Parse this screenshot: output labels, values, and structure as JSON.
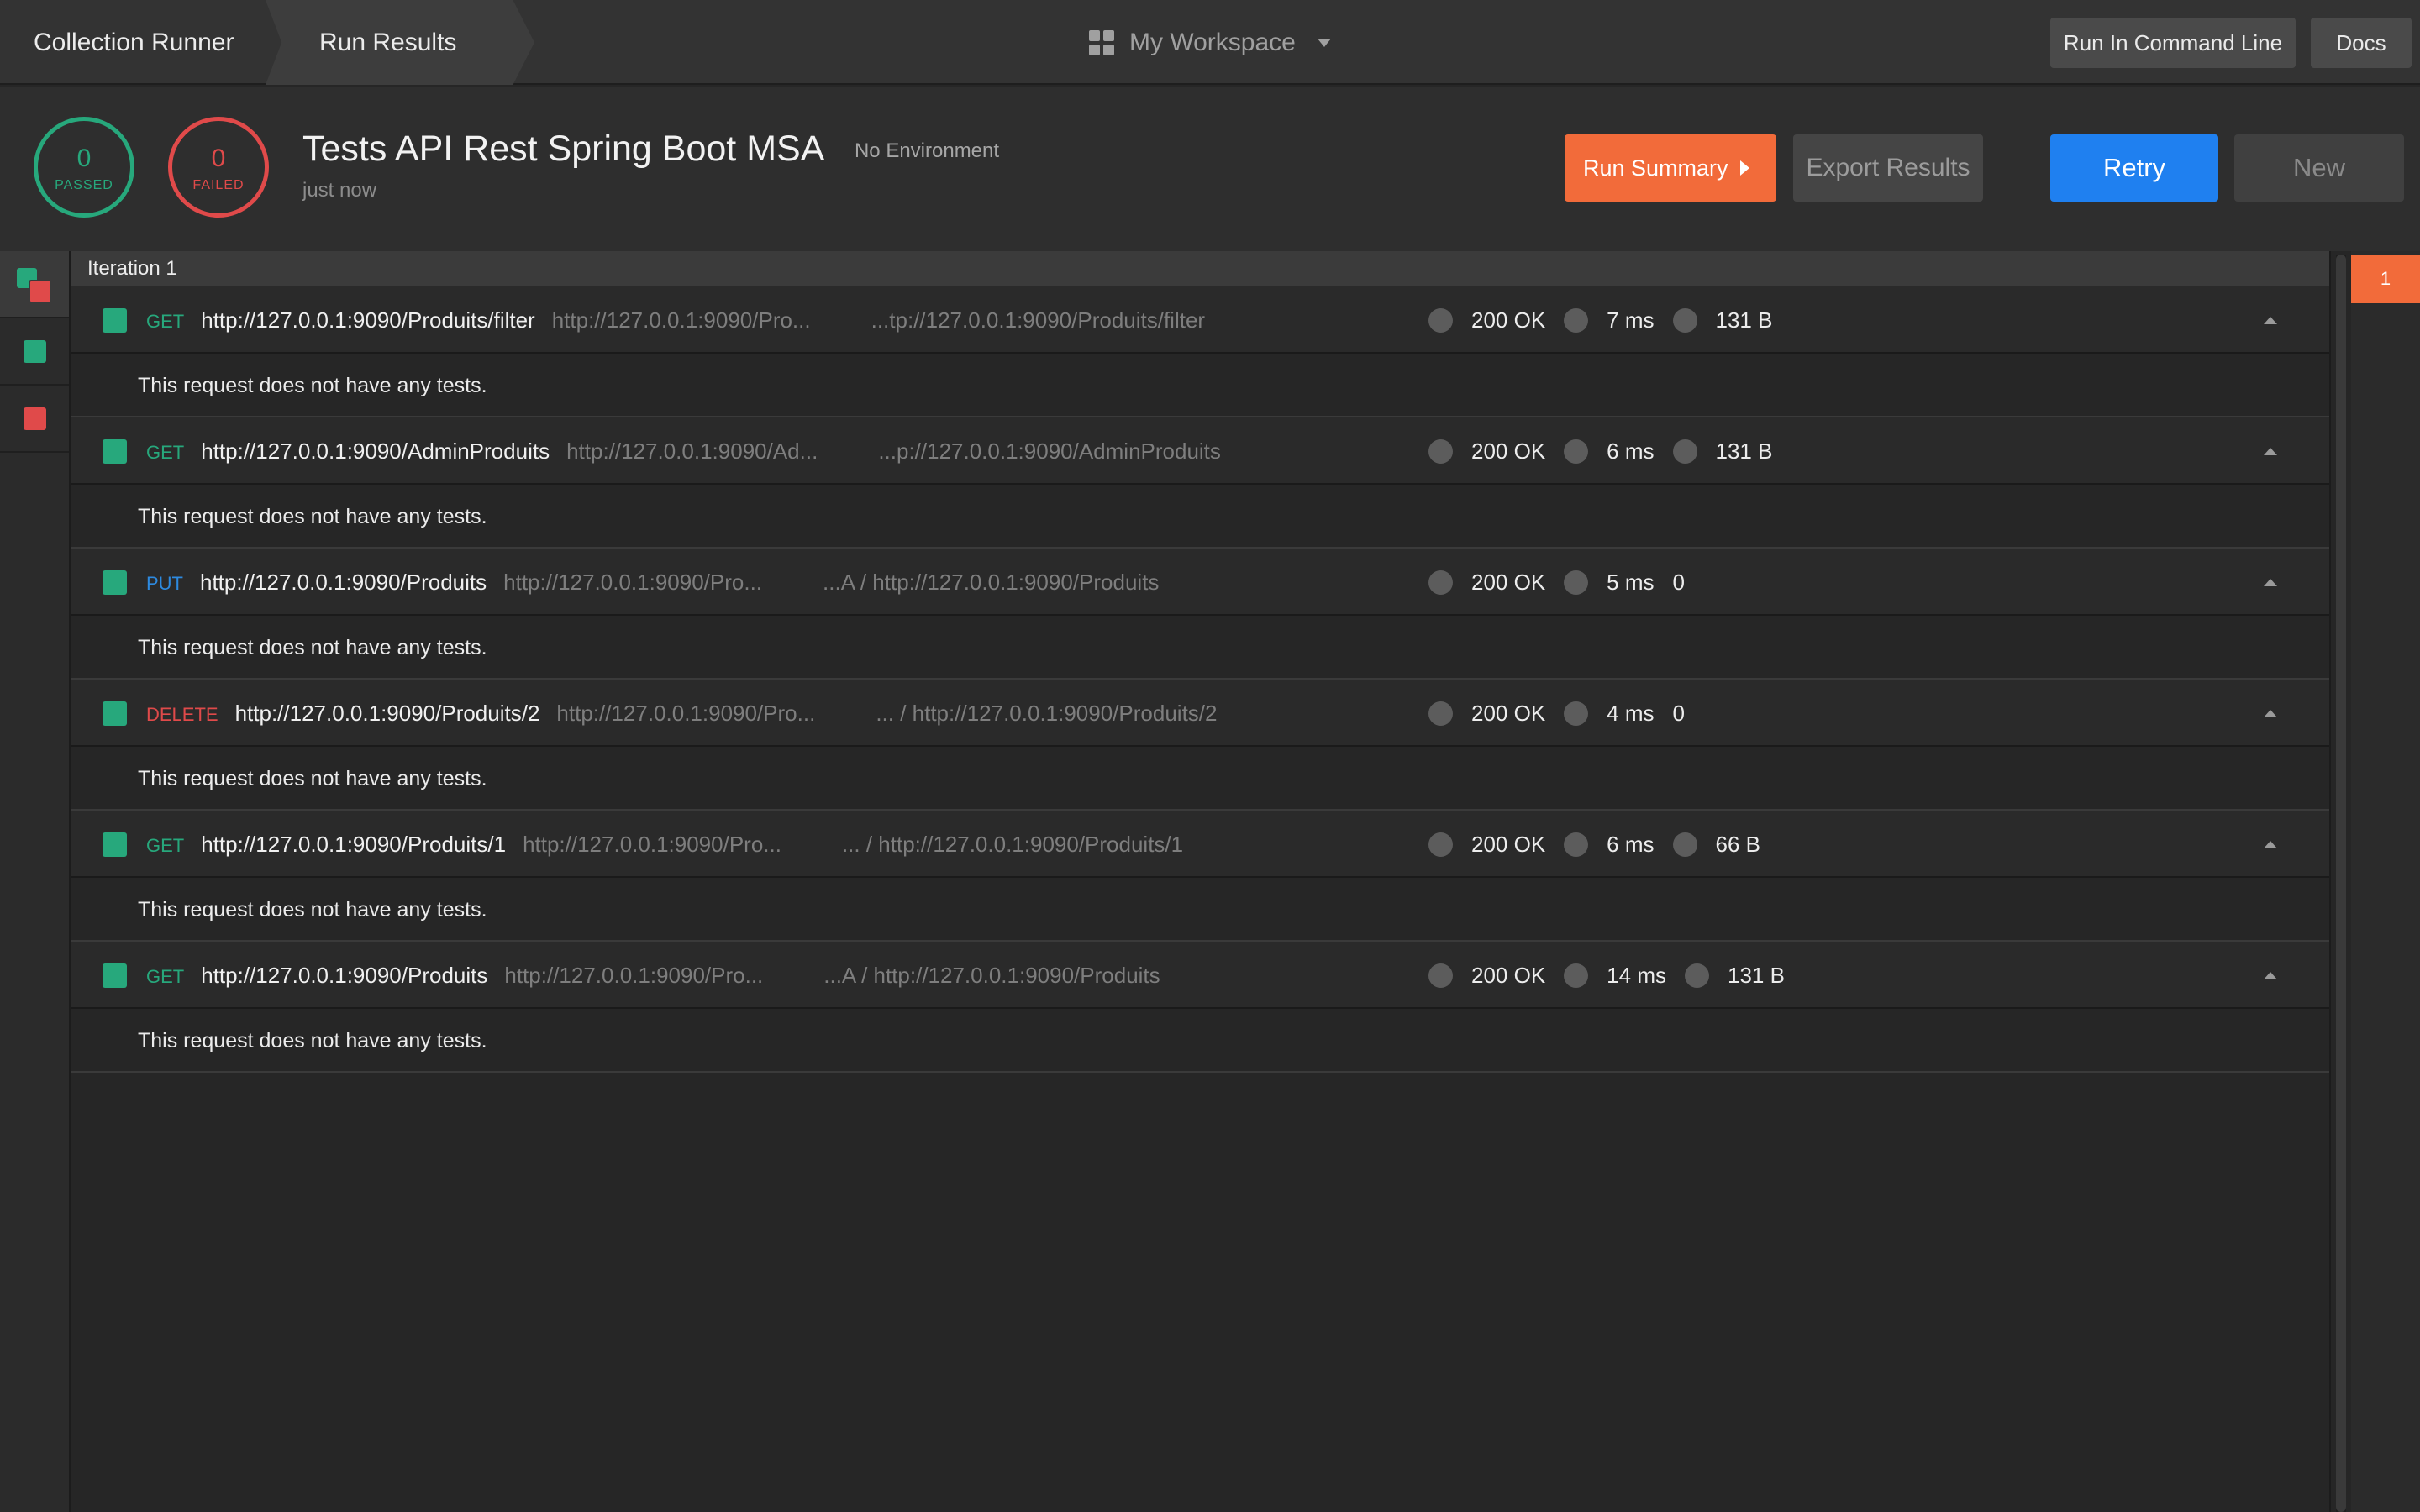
{
  "topbar": {
    "crumb_runner": "Collection Runner",
    "crumb_results": "Run Results",
    "workspace": "My Workspace",
    "run_cli_label": "Run In Command Line",
    "docs_label": "Docs"
  },
  "summary": {
    "passed_count": "0",
    "passed_label": "PASSED",
    "failed_count": "0",
    "failed_label": "FAILED",
    "title": "Tests API Rest Spring Boot MSA",
    "environment": "No Environment",
    "time": "just now"
  },
  "actions": {
    "run_summary": "Run Summary",
    "export": "Export Results",
    "retry": "Retry",
    "new": "New"
  },
  "iteration": {
    "label": "Iteration 1",
    "nav_number": "1"
  },
  "no_tests_text": "This request does not have any tests.",
  "requests": [
    {
      "method": "GET",
      "url": "http://127.0.0.1:9090/Produits/filter",
      "short": "http://127.0.0.1:9090/Pro...",
      "full": "...tp://127.0.0.1:9090/Produits/filter",
      "status": "200 OK",
      "time": "7 ms",
      "size": "131 B",
      "detail": "This request does not have any tests."
    },
    {
      "method": "GET",
      "url": "http://127.0.0.1:9090/AdminProduits",
      "short": "http://127.0.0.1:9090/Ad...",
      "full": "...p://127.0.0.1:9090/AdminProduits",
      "status": "200 OK",
      "time": "6 ms",
      "size": "131 B",
      "detail": "This request does not have any tests."
    },
    {
      "method": "PUT",
      "url": "http://127.0.0.1:9090/Produits",
      "short": "http://127.0.0.1:9090/Pro...",
      "full": "...A / http://127.0.0.1:9090/Produits",
      "status": "200 OK",
      "time": "5 ms",
      "size": "0",
      "detail": "This request does not have any tests."
    },
    {
      "method": "DELETE",
      "url": "http://127.0.0.1:9090/Produits/2",
      "short": "http://127.0.0.1:9090/Pro...",
      "full": "... / http://127.0.0.1:9090/Produits/2",
      "status": "200 OK",
      "time": "4 ms",
      "size": "0",
      "detail": "This request does not have any tests."
    },
    {
      "method": "GET",
      "url": "http://127.0.0.1:9090/Produits/1",
      "short": "http://127.0.0.1:9090/Pro...",
      "full": "... / http://127.0.0.1:9090/Produits/1",
      "status": "200 OK",
      "time": "6 ms",
      "size": "66 B",
      "detail": "This request does not have any tests."
    },
    {
      "method": "GET",
      "url": "http://127.0.0.1:9090/Produits",
      "short": "http://127.0.0.1:9090/Pro...",
      "full": "...A / http://127.0.0.1:9090/Produits",
      "status": "200 OK",
      "time": "14 ms",
      "size": "131 B",
      "detail": "This request does not have any tests."
    }
  ],
  "colors": {
    "passed": "#27a87c",
    "failed": "#e04a4a",
    "accent_orange": "#f26b3a",
    "primary_blue": "#1f80f0",
    "method_get": "#27a87c",
    "method_put": "#2d8ae0",
    "method_delete": "#e04a4a"
  },
  "icons": {
    "workspace": "grid-icon",
    "workspace_dropdown": "chevron-down-icon",
    "run_summary": "play-icon",
    "row_collapse": "chevron-up-icon"
  }
}
